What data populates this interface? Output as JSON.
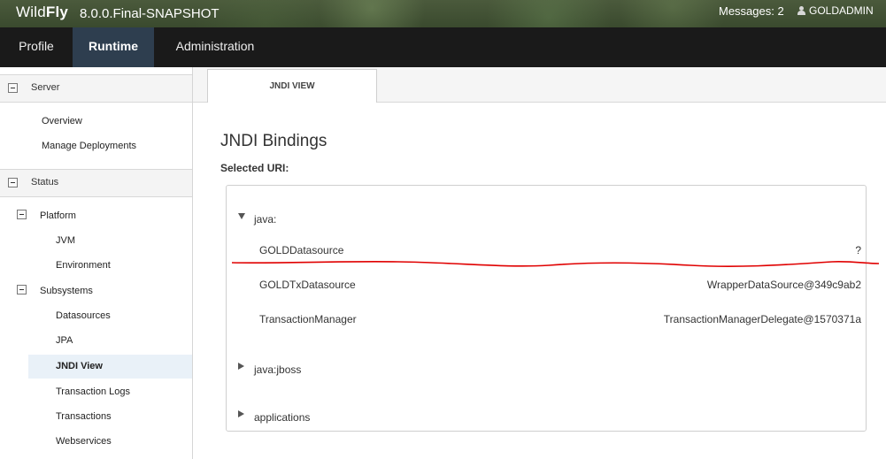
{
  "header": {
    "brand_light": "Wild",
    "brand_bold": "Fly",
    "version": "8.0.0.Final-SNAPSHOT",
    "messages": "Messages: 2",
    "user": "GOLDADMIN"
  },
  "nav": {
    "items": [
      "Profile",
      "Runtime",
      "Administration"
    ],
    "active": "Runtime"
  },
  "sidebar": {
    "server": {
      "label": "Server",
      "items": [
        "Overview",
        "Manage Deployments"
      ]
    },
    "status": {
      "label": "Status",
      "platform": {
        "label": "Platform",
        "items": [
          "JVM",
          "Environment"
        ]
      },
      "subsystems": {
        "label": "Subsystems",
        "items": [
          "Datasources",
          "JPA",
          "JNDI View",
          "Transaction Logs",
          "Transactions",
          "Webservices"
        ]
      }
    },
    "selected": "JNDI View"
  },
  "content": {
    "tab": "JNDI VIEW",
    "title": "JNDI Bindings",
    "selected_uri_label": "Selected URI:",
    "tree": {
      "java": {
        "label": "java:",
        "expanded": true,
        "entries": [
          {
            "name": "GOLDDatasource",
            "value": "?"
          },
          {
            "name": "GOLDTxDatasource",
            "value": "WrapperDataSource@349c9ab2"
          },
          {
            "name": "TransactionManager",
            "value": "TransactionManagerDelegate@1570371a"
          }
        ]
      },
      "java_jboss": {
        "label": "java:jboss",
        "expanded": false
      },
      "applications": {
        "label": "applications",
        "expanded": false
      }
    }
  },
  "colors": {
    "nav_bg": "#1a1a1a",
    "nav_active": "#2e3e4f",
    "selection": "#e9f1f8",
    "annotation": "#e00000"
  }
}
